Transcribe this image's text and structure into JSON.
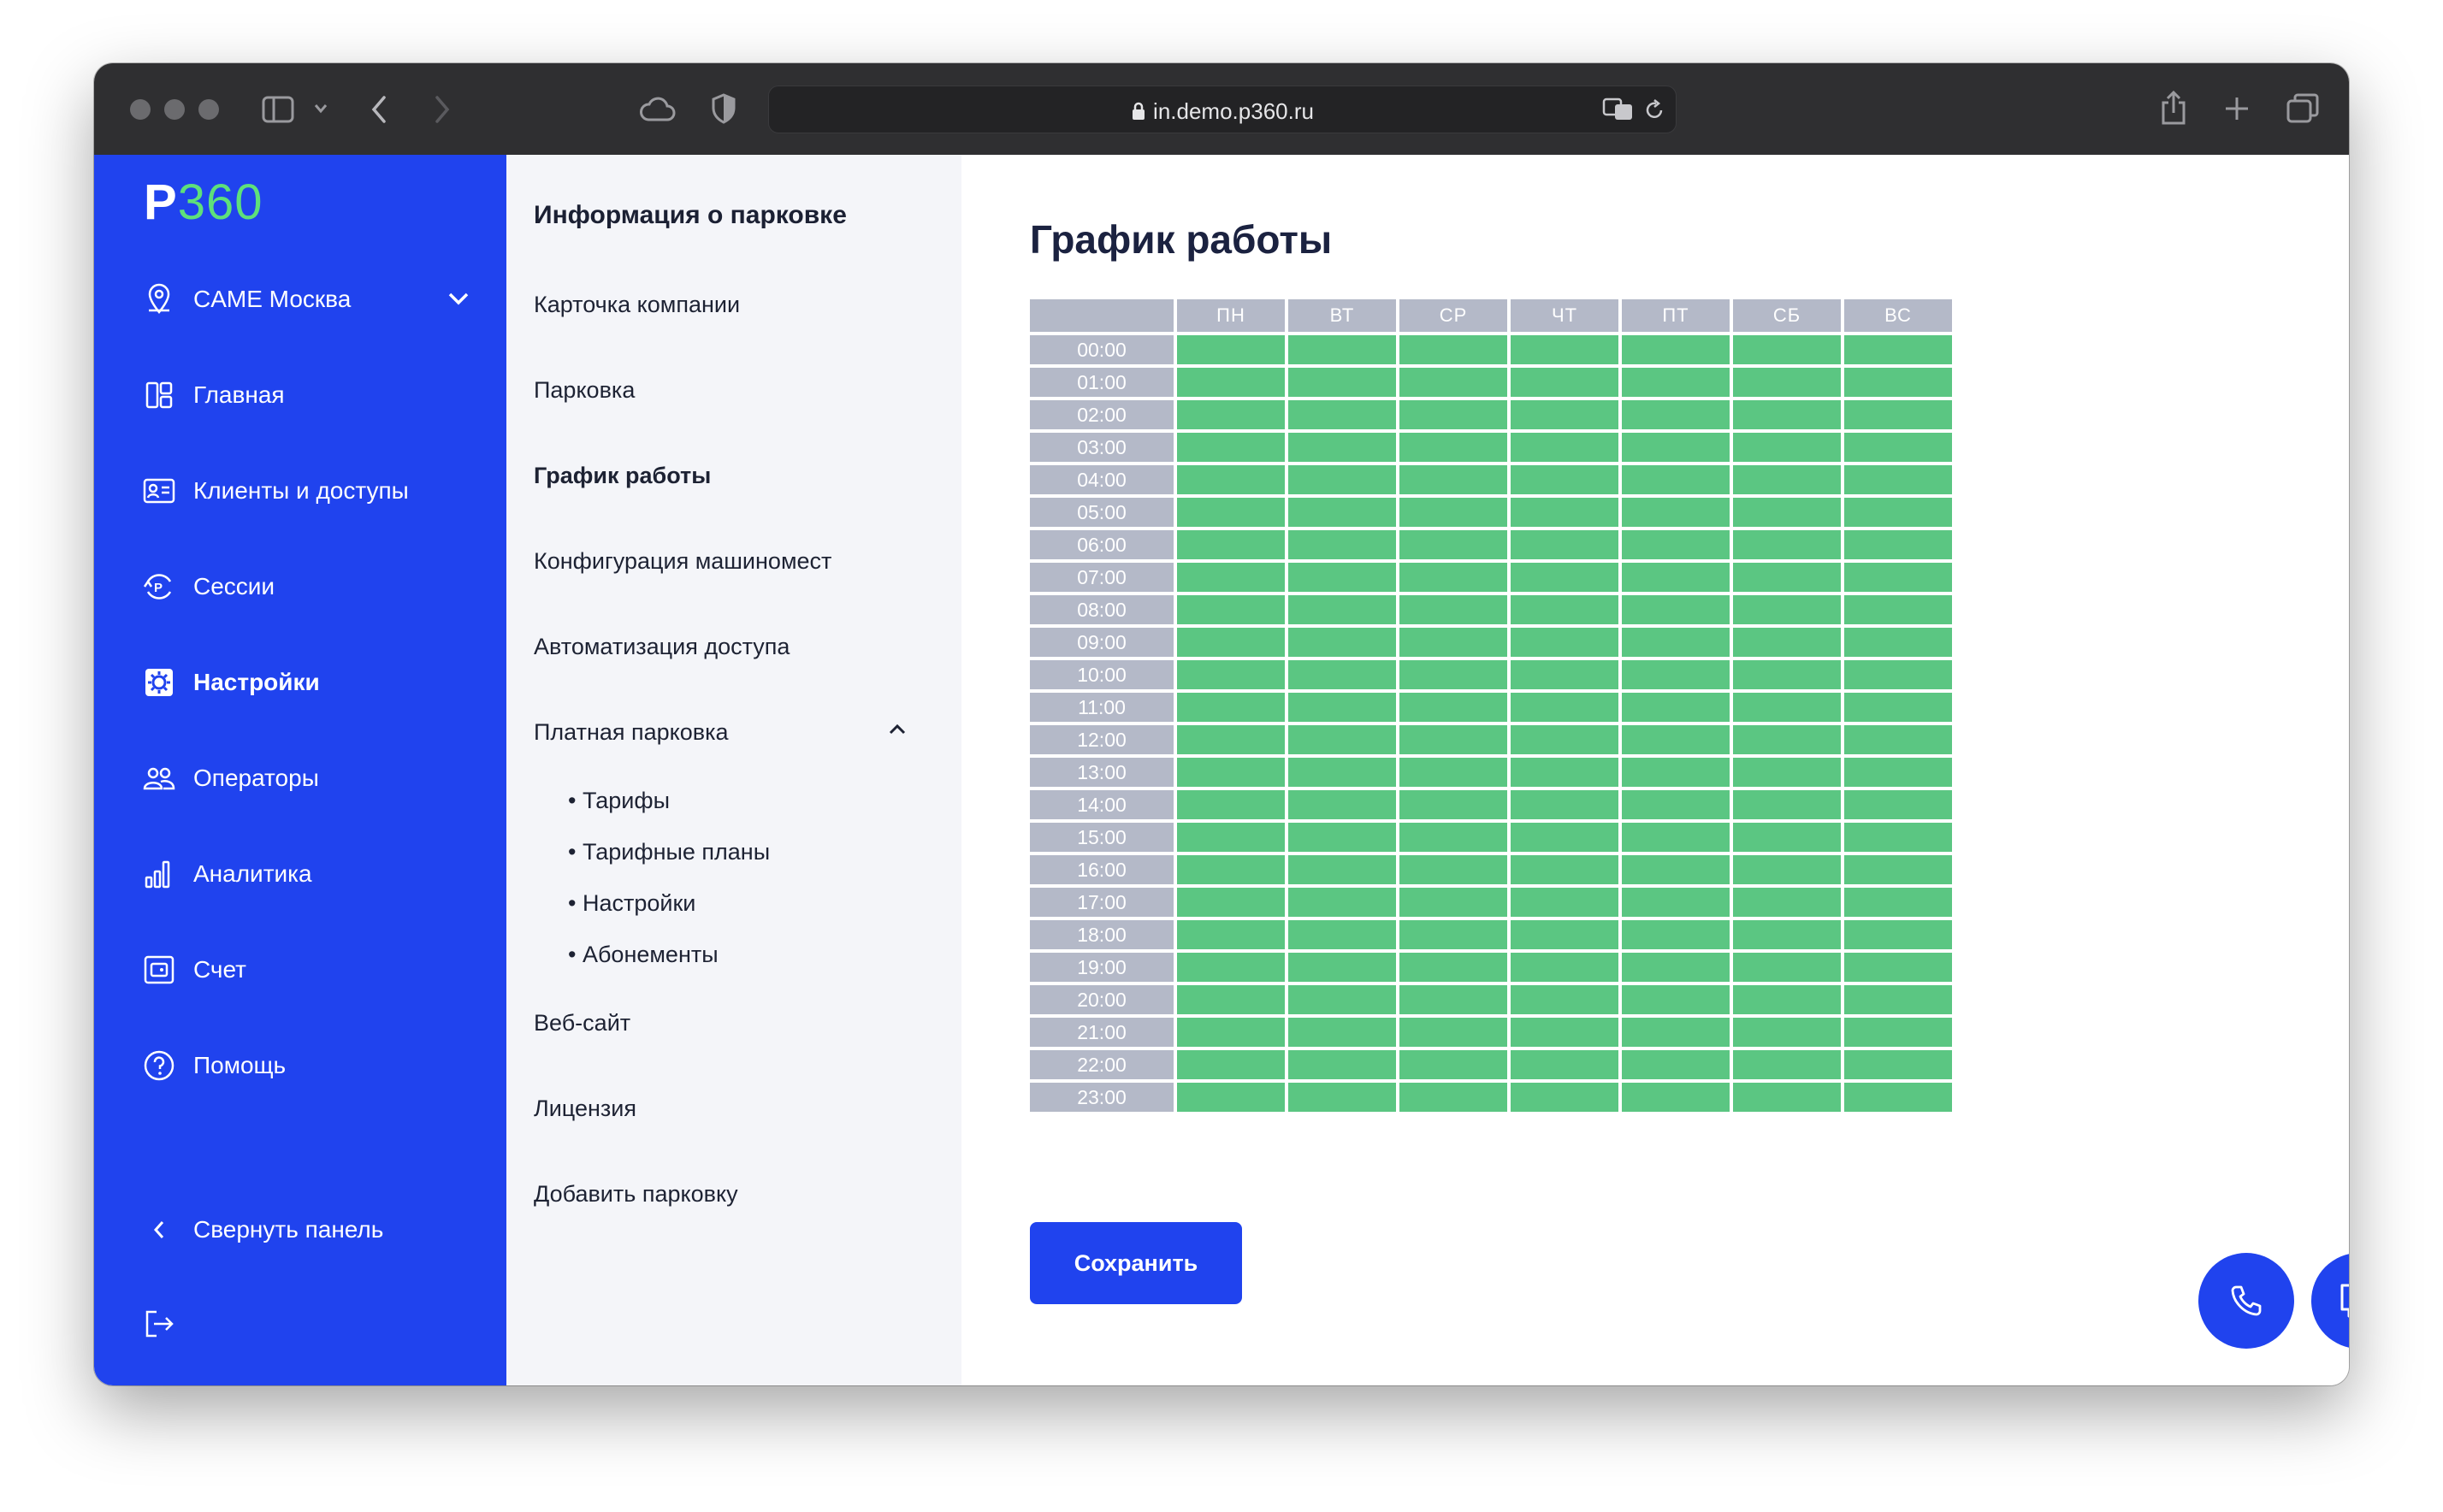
{
  "browser": {
    "url": "in.demo.p360.ru"
  },
  "logo": {
    "p": "P",
    "n": "360"
  },
  "sidebar": {
    "company": "CAME Москва",
    "items": [
      {
        "label": "Главная",
        "icon": "home-grid-icon"
      },
      {
        "label": "Клиенты и доступы",
        "icon": "id-card-icon"
      },
      {
        "label": "Сессии",
        "icon": "parking-cycle-icon"
      },
      {
        "label": "Настройки",
        "icon": "settings-icon"
      },
      {
        "label": "Операторы",
        "icon": "users-icon"
      },
      {
        "label": "Аналитика",
        "icon": "bar-chart-icon"
      },
      {
        "label": "Счет",
        "icon": "wallet-icon"
      },
      {
        "label": "Помощь",
        "icon": "help-icon"
      }
    ],
    "collapse": "Свернуть панель"
  },
  "submenu": {
    "title": "Информация о парковке",
    "items": [
      "Карточка компании",
      "Парковка",
      "График работы",
      "Конфигурация машиномест",
      "Автоматизация доступа",
      "Платная парковка"
    ],
    "paid_sub": [
      "• Тарифы",
      "• Тарифные планы",
      "• Настройки",
      "• Абонементы"
    ],
    "bottom": [
      "Веб-сайт",
      "Лицензия",
      "Добавить парковку"
    ]
  },
  "main": {
    "title": "График работы",
    "save": "Сохранить"
  },
  "schedule": {
    "days": [
      "ПН",
      "ВТ",
      "СР",
      "ЧТ",
      "ПТ",
      "СБ",
      "ВС"
    ],
    "hours": [
      "00:00",
      "01:00",
      "02:00",
      "03:00",
      "04:00",
      "05:00",
      "06:00",
      "07:00",
      "08:00",
      "09:00",
      "10:00",
      "11:00",
      "12:00",
      "13:00",
      "14:00",
      "15:00",
      "16:00",
      "17:00",
      "18:00",
      "19:00",
      "20:00",
      "21:00",
      "22:00",
      "23:00"
    ],
    "all_open": true
  },
  "colors": {
    "brand_blue": "#2043ee",
    "open_green": "#5bc682",
    "header_gray": "#b4b9c8",
    "logo_green": "#5ee07a"
  }
}
